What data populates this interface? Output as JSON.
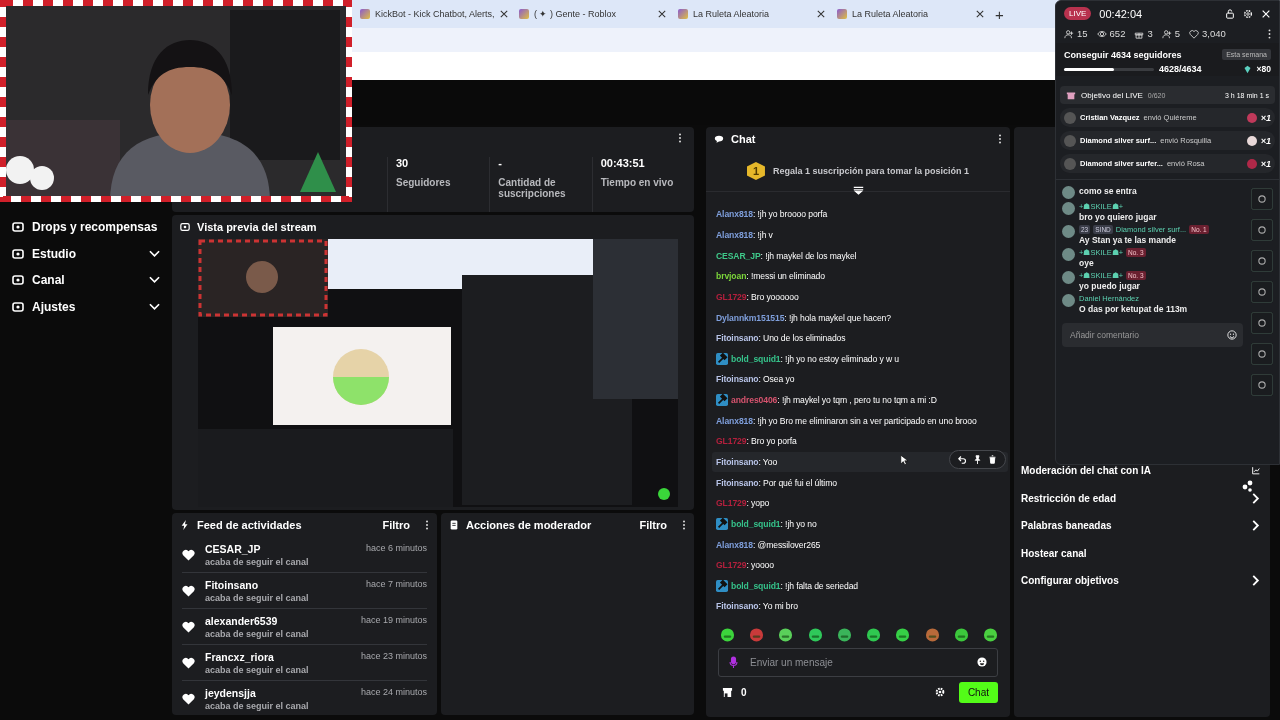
{
  "browser": {
    "tabs": [
      {
        "title": "KickBot - Kick Chatbot, Alerts,",
        "selected": false
      },
      {
        "title": "( ✦ ) Gente - Roblox",
        "selected": false
      },
      {
        "title": "La Ruleta Aleatoria",
        "selected": false
      },
      {
        "title": "La Ruleta Aleatoria",
        "selected": false
      }
    ],
    "new_tab": "+"
  },
  "sidebar": {
    "items": [
      {
        "label": "Drops y recompensas",
        "has_submenu": false
      },
      {
        "label": "Estudio",
        "has_submenu": true
      },
      {
        "label": "Canal",
        "has_submenu": true
      },
      {
        "label": "Ajustes",
        "has_submenu": true
      }
    ]
  },
  "stats": [
    {
      "value": "30",
      "label": "Seguidores"
    },
    {
      "value": "-",
      "label": "Cantidad de suscripciones"
    },
    {
      "value": "00:43:51",
      "label": "Tiempo en vivo"
    }
  ],
  "preview": {
    "title": "Vista previa del stream",
    "kind": "picture"
  },
  "activity_feed": {
    "title": "Feed de actividades",
    "filter": "Filtro",
    "items": [
      {
        "name": "CESAR_JP",
        "time": "hace 6 minutos",
        "action": "acaba de seguir el canal"
      },
      {
        "name": "Fitoinsano",
        "time": "hace 7 minutos",
        "action": "acaba de seguir el canal"
      },
      {
        "name": "alexander6539",
        "time": "hace 19 minutos",
        "action": "acaba de seguir el canal"
      },
      {
        "name": "Francxz_riora",
        "time": "hace 23 minutos",
        "action": "acaba de seguir el canal"
      },
      {
        "name": "jeydensjja",
        "time": "hace 24 minutos",
        "action": "acaba de seguir el canal"
      }
    ]
  },
  "mod_actions": {
    "title": "Acciones de moderador",
    "filter": "Filtro"
  },
  "chat": {
    "title": "Chat",
    "gift_rank": "1",
    "gift_prompt": "Regala 1 suscripción para tomar la posición 1",
    "messages": [
      {
        "user": "Alanx818",
        "color": "#7f9fdc",
        "moderator": false,
        "highlighted": false,
        "text": "!jh yo broooo porfa"
      },
      {
        "user": "Alanx818",
        "color": "#7f9fdc",
        "moderator": false,
        "highlighted": false,
        "text": "!jh v"
      },
      {
        "user": "CESAR_JP",
        "color": "#3fc98a",
        "moderator": false,
        "highlighted": false,
        "text": "!jh maykel de los maykel"
      },
      {
        "user": "brvjoan",
        "color": "#7cd63a",
        "moderator": false,
        "highlighted": false,
        "text": "!messi un eliminado"
      },
      {
        "user": "GL1729",
        "color": "#b3203d",
        "moderator": false,
        "highlighted": false,
        "text": "Bro yoooooo"
      },
      {
        "user": "Dylannkm151515",
        "color": "#7f9fdc",
        "moderator": false,
        "highlighted": false,
        "text": "!jh hola maykel que hacen?"
      },
      {
        "user": "Fitoinsano",
        "color": "#b8c4e8",
        "moderator": false,
        "highlighted": false,
        "text": "Uno de los eliminados"
      },
      {
        "user": "bold_squid1",
        "color": "#35c28a",
        "moderator": true,
        "highlighted": false,
        "text": "!jh yo no estoy eliminado y w u"
      },
      {
        "user": "Fitoinsano",
        "color": "#b8c4e8",
        "moderator": false,
        "highlighted": false,
        "text": "Osea yo"
      },
      {
        "user": "andres0406",
        "color": "#d6536e",
        "moderator": true,
        "highlighted": false,
        "text": "!jh maykel yo tqm , pero tu no tqm a mi :D"
      },
      {
        "user": "Alanx818",
        "color": "#7f9fdc",
        "moderator": false,
        "highlighted": false,
        "text": "!jh yo Bro me eliminaron sin a ver participado en uno brooo"
      },
      {
        "user": "GL1729",
        "color": "#b3203d",
        "moderator": false,
        "highlighted": false,
        "text": "Bro yo porfa"
      },
      {
        "user": "Fitoinsano",
        "color": "#b8c4e8",
        "moderator": false,
        "highlighted": true,
        "text": "Yoo"
      },
      {
        "user": "Fitoinsano",
        "color": "#b8c4e8",
        "moderator": false,
        "highlighted": false,
        "text": "Por qué fui el último"
      },
      {
        "user": "GL1729",
        "color": "#b3203d",
        "moderator": false,
        "highlighted": false,
        "text": "yopo"
      },
      {
        "user": "bold_squid1",
        "color": "#35c28a",
        "moderator": true,
        "highlighted": false,
        "text": "!jh yo no"
      },
      {
        "user": "Alanx818",
        "color": "#7f9fdc",
        "moderator": false,
        "highlighted": false,
        "text": "@messilover265"
      },
      {
        "user": "GL1729",
        "color": "#b3203d",
        "moderator": false,
        "highlighted": false,
        "text": "yoooo"
      },
      {
        "user": "bold_squid1",
        "color": "#35c28a",
        "moderator": true,
        "highlighted": false,
        "text": "!jh falta de seriedad"
      },
      {
        "user": "Fitoinsano",
        "color": "#b8c4e8",
        "moderator": false,
        "highlighted": false,
        "text": "Yo mi bro"
      }
    ],
    "separator": ":",
    "placeholder": "Enviar un mensaje",
    "points": "0",
    "send": "Chat"
  },
  "channel_actions": {
    "items": [
      {
        "label": "Moderación del chat con IA",
        "kind": "external"
      },
      {
        "label": "Restricción de edad",
        "kind": "submenu"
      },
      {
        "label": "Palabras baneadas",
        "kind": "submenu"
      },
      {
        "label": "Hostear canal",
        "kind": "plain"
      },
      {
        "label": "Configurar objetivos",
        "kind": "submenu"
      }
    ]
  },
  "live_overlay": {
    "badge": "LIVE",
    "elapsed": "00:42:04",
    "stats": [
      {
        "kind": "viewers",
        "value": "15"
      },
      {
        "kind": "views",
        "value": "652"
      },
      {
        "kind": "gifts",
        "value": "3"
      },
      {
        "kind": "follows",
        "value": "5"
      },
      {
        "kind": "likes",
        "value": "3,040"
      }
    ],
    "goal": {
      "title": "Conseguir 4634 seguidores",
      "period": "Esta semana",
      "progress": "4628/4634",
      "level": 0.55,
      "multiplier": "×80"
    },
    "live_goal": {
      "title": "Objetivo del LIVE",
      "count": "0/620",
      "remaining": "3 h 18 min 1 s"
    },
    "gifts": [
      {
        "user": "Cristian Vazquez",
        "action": "envió Quiéreme",
        "count": "×1",
        "color": "#c0395a"
      },
      {
        "user": "Diamond silver surf...",
        "action": "envió Rosquilla",
        "count": "×1",
        "color": "#e8d8d8"
      },
      {
        "user": "Diamond silver surfer...",
        "action": "envió Rosa",
        "count": "×1",
        "color": "#b02848"
      }
    ],
    "messages": [
      {
        "text": "como se entra"
      },
      {
        "user": "+☗SKILE☗+",
        "text": "bro yo quiero jugar"
      },
      {
        "level_badge": "23",
        "club_badge": "SIND",
        "user": "Diamond silver surf...",
        "rank": "No. 1",
        "text": "Ay Stan ya te las mande"
      },
      {
        "user": "+☗SKILE☗+",
        "rank": "No. 3",
        "text": "oye"
      },
      {
        "user": "+☗SKILE☗+",
        "rank": "No. 3",
        "text": "yo puedo jugar"
      },
      {
        "user": "Daniel Hernández",
        "text": "O das por ketupat de 113m"
      }
    ],
    "comment_placeholder": "Añadir comentario"
  }
}
